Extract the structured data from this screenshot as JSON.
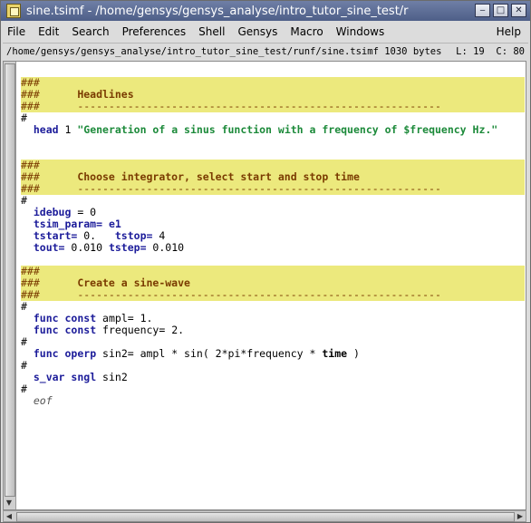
{
  "window": {
    "title": "sine.tsimf - /home/gensys/gensys_analyse/intro_tutor_sine_test/r",
    "buttons": {
      "minimize": "‒",
      "maximize": "□",
      "close": "✕"
    }
  },
  "menu": {
    "file": "File",
    "edit": "Edit",
    "search": "Search",
    "preferences": "Preferences",
    "shell": "Shell",
    "gensys": "Gensys",
    "macro": "Macro",
    "windows": "Windows",
    "help": "Help"
  },
  "statusbar": {
    "path": "/home/gensys/gensys_analyse/intro_tutor_sine_test/runf/sine.tsimf 1030 bytes",
    "position": "L: 19  C: 80"
  },
  "code": {
    "block1": {
      "hash1": "###",
      "hash2": "###      ",
      "title": "Headlines",
      "hash3": "###      ",
      "dashes": "----------------------------------------------------------"
    },
    "sep1": "#",
    "head_kw": "head",
    "head_num": " 1 ",
    "head_str": "\"Generation of a sinus function with a frequency of $frequency Hz.\"",
    "block2": {
      "hash1": "###",
      "hash2": "###      ",
      "title": "Choose integrator, select start and stop time",
      "hash3": "###      ",
      "dashes": "----------------------------------------------------------"
    },
    "sep2": "#",
    "idebug_kw": "idebug",
    "idebug_val": " = 0",
    "tsim_kw": "tsim_param=",
    "tsim_val": " e1",
    "tstart_kw": "tstart=",
    "tstart_val": " 0.   ",
    "tstop_kw": "tstop=",
    "tstop_val": " 4",
    "tout_kw": "tout=",
    "tout_val": " 0.010 ",
    "tstep_kw": "tstep=",
    "tstep_val": " 0.010",
    "block3": {
      "hash1": "###",
      "hash2": "###      ",
      "title": "Create a sine-wave",
      "hash3": "###      ",
      "dashes": "----------------------------------------------------------"
    },
    "sep3": "#",
    "func_kw": "func",
    "const_kw": "const",
    "ampl_val": " ampl= 1.",
    "func2_kw": "func",
    "const2_kw": "const",
    "freq_val": " frequency= 2.",
    "sep4": "#",
    "func3_kw": "func",
    "operp_kw": "operp",
    "sin_val": " sin2= ampl * sin( 2*pi*frequency * ",
    "time_kw": "time",
    "sin_end": " )",
    "sep5": "#",
    "svar_kw": "s_var",
    "sngl_kw": "sngl",
    "svar_val": " sin2",
    "sep6": "#",
    "eof": "eof"
  }
}
